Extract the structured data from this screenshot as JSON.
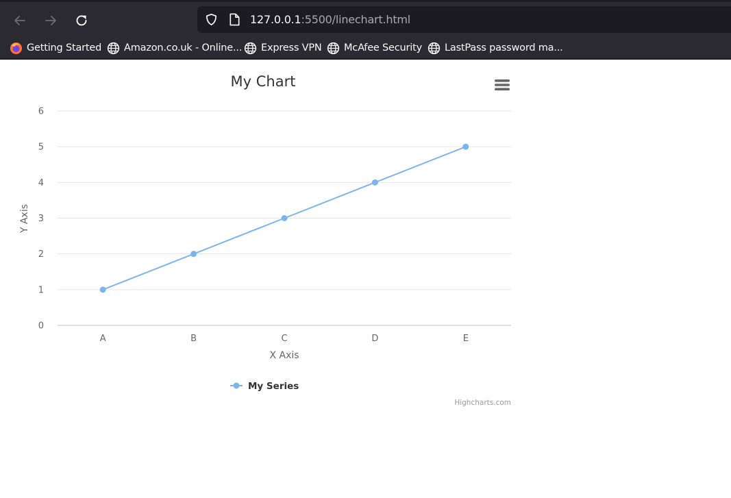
{
  "browser": {
    "url_host": "127.0.0.1",
    "url_rest": ":5500/linechart.html",
    "bookmarks": [
      {
        "label": "Getting Started",
        "icon": "firefox-icon"
      },
      {
        "label": "Amazon.co.uk - Online...",
        "icon": "globe-icon"
      },
      {
        "label": "Express VPN",
        "icon": "globe-icon"
      },
      {
        "label": "McAfee Security",
        "icon": "globe-icon"
      },
      {
        "label": "LastPass password ma...",
        "icon": "globe-icon"
      }
    ]
  },
  "chart_data": {
    "type": "line",
    "title": "My Chart",
    "xlabel": "X Axis",
    "ylabel": "Y Axis",
    "categories": [
      "A",
      "B",
      "C",
      "D",
      "E"
    ],
    "series": [
      {
        "name": "My Series",
        "values": [
          1,
          2,
          3,
          4,
          5
        ],
        "color": "#7cb5ec"
      }
    ],
    "ylim": [
      0,
      6
    ],
    "yticks": [
      0,
      1,
      2,
      3,
      4,
      5,
      6
    ],
    "grid": true,
    "legend": "bottom-center",
    "credits": "Highcharts.com",
    "menu_icon": "hamburger-menu-icon"
  }
}
